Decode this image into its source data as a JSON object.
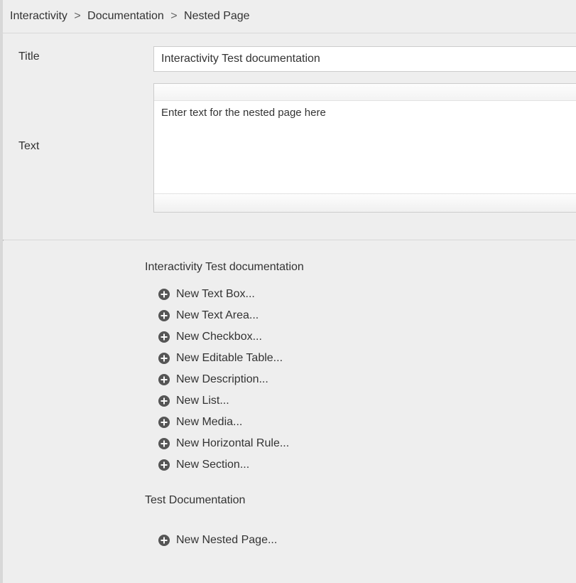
{
  "breadcrumb": {
    "items": [
      "Interactivity",
      "Documentation",
      "Nested Page"
    ],
    "sep": ">"
  },
  "form": {
    "titleLabel": "Title",
    "titleValue": "Interactivity Test documentation",
    "textLabel": "Text",
    "textPlaceholder": "Enter text for the nested page here"
  },
  "tree": {
    "sections": [
      {
        "heading": "Interactivity Test documentation",
        "items": [
          "New Text Box...",
          "New Text Area...",
          "New Checkbox...",
          "New Editable Table...",
          "New Description...",
          "New List...",
          "New Media...",
          "New Horizontal Rule...",
          "New Section..."
        ]
      },
      {
        "heading": "Test Documentation",
        "items": [
          "New Nested Page..."
        ]
      }
    ]
  }
}
